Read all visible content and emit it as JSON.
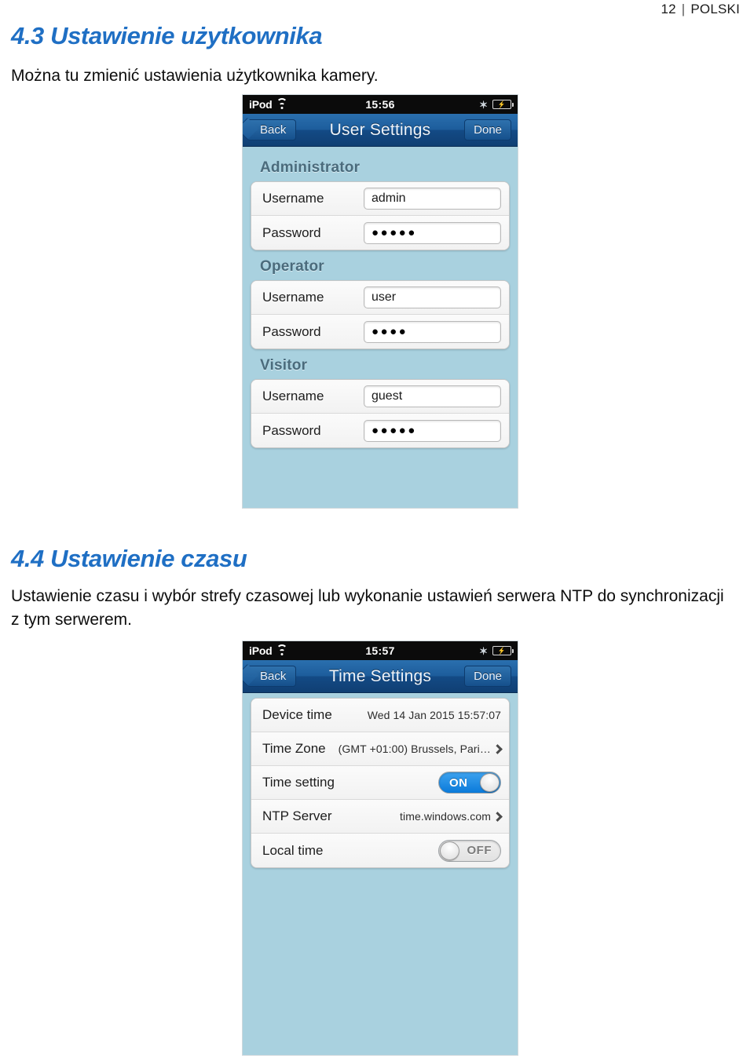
{
  "page": {
    "number": "12",
    "separator": "|",
    "language": "POLSKI"
  },
  "sections": [
    {
      "heading": "4.3 Ustawienie użytkownika",
      "paragraph": "Można tu zmienić ustawienia użytkownika kamery."
    },
    {
      "heading": "4.4 Ustawienie czasu",
      "paragraph": "Ustawienie czasu i wybór strefy czasowej lub wykonanie ustawień serwera NTP do synchronizacji z tym serwerem."
    }
  ],
  "user_settings_screenshot": {
    "statusbar": {
      "carrier": "iPod",
      "wifi_icon": "wifi-icon",
      "time": "15:56",
      "bluetooth_icon": "bluetooth-icon",
      "battery_icon": "battery-charging-icon",
      "battery_glyph": "⚡"
    },
    "navbar": {
      "back_label": "Back",
      "title": "User Settings",
      "done_label": "Done"
    },
    "groups": [
      {
        "label": "Administrator",
        "rows": [
          {
            "label": "Username",
            "value": "admin",
            "type": "text"
          },
          {
            "label": "Password",
            "value": "●●●●●",
            "type": "password"
          }
        ]
      },
      {
        "label": "Operator",
        "rows": [
          {
            "label": "Username",
            "value": "user",
            "type": "text"
          },
          {
            "label": "Password",
            "value": "●●●●",
            "type": "password"
          }
        ]
      },
      {
        "label": "Visitor",
        "rows": [
          {
            "label": "Username",
            "value": "guest",
            "type": "text"
          },
          {
            "label": "Password",
            "value": "●●●●●",
            "type": "password"
          }
        ]
      }
    ]
  },
  "time_settings_screenshot": {
    "statusbar": {
      "carrier": "iPod",
      "wifi_icon": "wifi-icon",
      "time": "15:57",
      "bluetooth_icon": "bluetooth-icon",
      "battery_icon": "battery-charging-icon",
      "battery_glyph": "⚡"
    },
    "navbar": {
      "back_label": "Back",
      "title": "Time Settings",
      "done_label": "Done"
    },
    "rows": [
      {
        "label": "Device time",
        "value": "Wed 14 Jan 2015  15:57:07",
        "type": "value"
      },
      {
        "label": "Time Zone",
        "value": "(GMT +01:00) Brussels, Pari…",
        "type": "disclosure"
      },
      {
        "label": "Time setting",
        "value": "ON",
        "type": "toggle",
        "state": "on"
      },
      {
        "label": "NTP Server",
        "value": "time.windows.com",
        "type": "disclosure"
      },
      {
        "label": "Local time",
        "value": "OFF",
        "type": "toggle",
        "state": "off"
      }
    ]
  },
  "colors": {
    "heading_blue": "#1f6fc4",
    "screen_background": "#a9d1df",
    "navbar_blue": "#1d5d9c",
    "toggle_on": "#0a7ada",
    "group_label": "#4a6b7c"
  }
}
